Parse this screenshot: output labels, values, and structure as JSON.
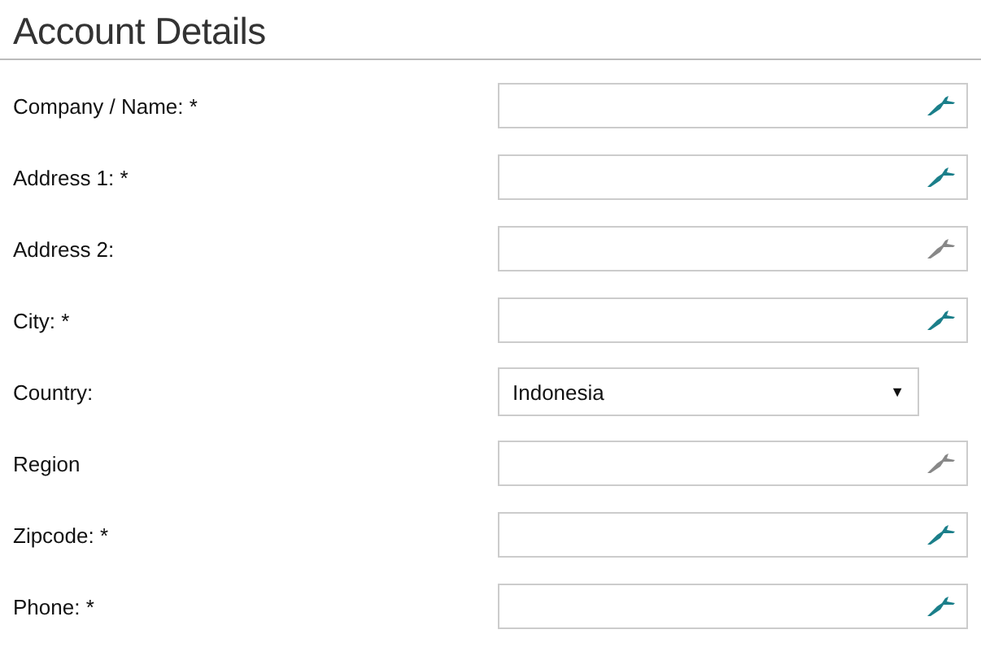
{
  "title": "Account Details",
  "fields": [
    {
      "label": "Company / Name: *",
      "kind": "text",
      "required": true
    },
    {
      "label": "Address 1: *",
      "kind": "text",
      "required": true
    },
    {
      "label": "Address 2:",
      "kind": "text",
      "required": false
    },
    {
      "label": "City: *",
      "kind": "text",
      "required": true
    },
    {
      "label": "Country:",
      "kind": "select",
      "value": "Indonesia",
      "caret": "▼"
    },
    {
      "label": "Region",
      "kind": "text",
      "required": false
    },
    {
      "label": "Zipcode: *",
      "kind": "text",
      "required": true
    },
    {
      "label": "Phone: *",
      "kind": "text",
      "required": true
    }
  ]
}
